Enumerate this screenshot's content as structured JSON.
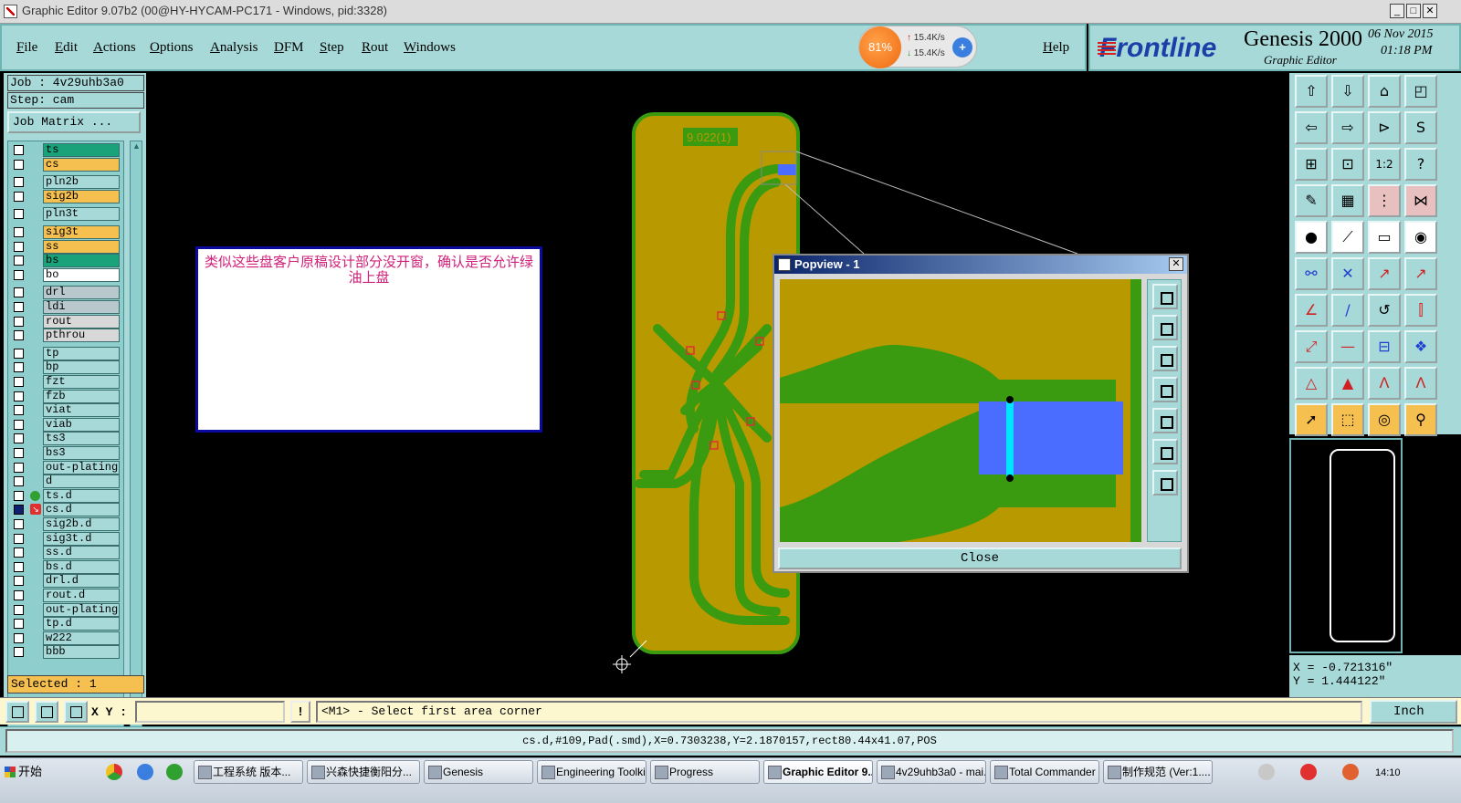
{
  "window": {
    "title": "Graphic Editor 9.07b2 (00@HY-HYCAM-PC171 - Windows, pid:3328)",
    "controls": [
      "_",
      "□",
      "✕"
    ]
  },
  "menu": {
    "items": [
      "File",
      "Edit",
      "Actions",
      "Options",
      "Analysis",
      "DFM",
      "Step",
      "Rout",
      "Windows"
    ],
    "help": "Help"
  },
  "net_widget": {
    "percent": "81%",
    "up": "15.4K/s",
    "down": "15.4K/s",
    "plus": "+"
  },
  "brand": {
    "logo": "Frontline",
    "product": "Genesis 2000",
    "subtitle": "Graphic Editor",
    "date": "06 Nov 2015",
    "time": "01:18 PM"
  },
  "job": {
    "job_label": "Job : 4v29uhb3a0",
    "step_label": "Step: cam",
    "matrix_button": "Job Matrix ...",
    "selected": "Selected : 1"
  },
  "layers": [
    {
      "name": "ts",
      "color": "#1aa37a",
      "checked": false
    },
    {
      "name": "cs",
      "color": "#f5c050",
      "checked": false
    },
    {
      "name": "pln2b",
      "color": "#a6d9d8",
      "checked": false
    },
    {
      "name": "sig2b",
      "color": "#f5c050",
      "checked": false
    },
    {
      "name": "pln3t",
      "color": "#a6d9d8",
      "checked": false
    },
    {
      "name": "sig3t",
      "color": "#f5c050",
      "checked": false
    },
    {
      "name": "ss",
      "color": "#f5c050",
      "checked": false
    },
    {
      "name": "bs",
      "color": "#1aa37a",
      "checked": false
    },
    {
      "name": "bo",
      "color": "#ffffff",
      "checked": false
    },
    {
      "name": "drl",
      "color": "#b8c8cc",
      "checked": false
    },
    {
      "name": "ldi",
      "color": "#b8c8cc",
      "checked": false
    },
    {
      "name": "rout",
      "color": "#d8d8d8",
      "checked": false
    },
    {
      "name": "pthrou",
      "color": "#d8d8d8",
      "checked": false
    },
    {
      "name": "tp",
      "color": "#a6d9d8",
      "checked": false
    },
    {
      "name": "bp",
      "color": "#a6d9d8",
      "checked": false
    },
    {
      "name": "fzt",
      "color": "#a6d9d8",
      "checked": false
    },
    {
      "name": "fzb",
      "color": "#a6d9d8",
      "checked": false
    },
    {
      "name": "viat",
      "color": "#a6d9d8",
      "checked": false
    },
    {
      "name": "viab",
      "color": "#a6d9d8",
      "checked": false
    },
    {
      "name": "ts3",
      "color": "#a6d9d8",
      "checked": false
    },
    {
      "name": "bs3",
      "color": "#a6d9d8",
      "checked": false
    },
    {
      "name": "out-plating",
      "color": "#a6d9d8",
      "checked": false
    },
    {
      "name": "d",
      "color": "#a6d9d8",
      "checked": false
    },
    {
      "name": "ts.d",
      "color": "#a6d9d8",
      "checked": false,
      "marker": "green-dot"
    },
    {
      "name": "cs.d",
      "color": "#a6d9d8",
      "checked": true,
      "marker": "work-icon"
    },
    {
      "name": "sig2b.d",
      "color": "#a6d9d8",
      "checked": false
    },
    {
      "name": "sig3t.d",
      "color": "#a6d9d8",
      "checked": false
    },
    {
      "name": "ss.d",
      "color": "#a6d9d8",
      "checked": false
    },
    {
      "name": "bs.d",
      "color": "#a6d9d8",
      "checked": false
    },
    {
      "name": "drl.d",
      "color": "#a6d9d8",
      "checked": false
    },
    {
      "name": "rout.d",
      "color": "#a6d9d8",
      "checked": false
    },
    {
      "name": "out-plating",
      "color": "#a6d9d8",
      "checked": false
    },
    {
      "name": "tp.d",
      "color": "#a6d9d8",
      "checked": false
    },
    {
      "name": "w222",
      "color": "#a6d9d8",
      "checked": false
    },
    {
      "name": "bbb",
      "color": "#a6d9d8",
      "checked": false
    }
  ],
  "canvas": {
    "board_label": "9.022(1)",
    "annotation": "类似这些盘客户原稿设计部分没开窗，确认是否允许绿油上盘",
    "colors": {
      "board": "#b89a00",
      "copper": "#3a9a10",
      "pad": "#4a6cff",
      "cursor": "#00e5ff"
    }
  },
  "popview": {
    "title": "Popview - 1",
    "close_label": "Close"
  },
  "coords": {
    "x": "X = -0.721316\"",
    "y": "Y = 1.444122\""
  },
  "command": {
    "xy_label": "X Y :",
    "xy_value": "",
    "warn": "!",
    "prompt": "<M1> - Select first area corner",
    "unit": "Inch"
  },
  "status": "cs.d,#109,Pad(.smd),X=0.7303238,Y=2.1870157,rect80.44x41.07,POS",
  "taskbar": {
    "start": "开始",
    "tasks": [
      {
        "label": "工程系统  版本...",
        "active": false
      },
      {
        "label": "兴森快捷衡阳分...",
        "active": false
      },
      {
        "label": "Genesis",
        "active": false
      },
      {
        "label": "Engineering Toolki...",
        "active": false
      },
      {
        "label": "Progress",
        "active": false
      },
      {
        "label": "Graphic Editor 9....",
        "active": true
      },
      {
        "label": "4v29uhb3a0 - mai...",
        "active": false
      },
      {
        "label": "Total Commander ...",
        "active": false
      },
      {
        "label": "制作规范 (Ver:1....",
        "active": false
      }
    ],
    "clock": "14:10"
  }
}
